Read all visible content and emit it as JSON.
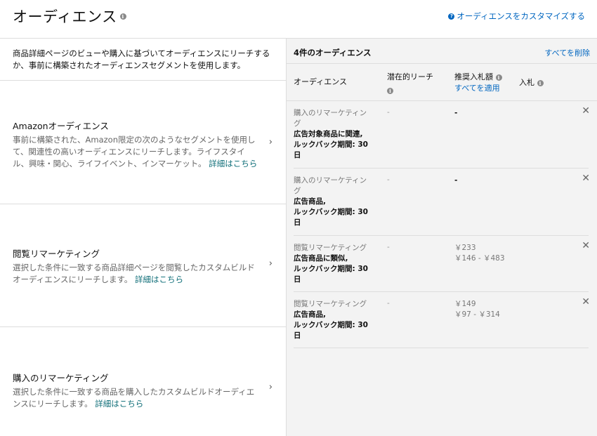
{
  "header": {
    "title": "オーディエンス",
    "info_icon": "info-icon",
    "customize_label": "オーディエンスをカスタマイズする",
    "customize_icon": "help-icon"
  },
  "intro": "商品詳細ページのビューや購入に基づいてオーディエンスにリーチするか、事前に構築されたオーディエンスセグメントを使用します。",
  "panels": [
    {
      "title": "Amazonオーディエンス",
      "description": "事前に構築された、Amazon限定の次のようなセグメントを使用して、関連性の高いオーディエンスにリーチします。ライフスタイル、興味・関心、ライフイベント、インマーケット。",
      "more": "詳細はこちら"
    },
    {
      "title": "閲覧リマーケティング",
      "description": "選択した条件に一致する商品詳細ページを閲覧したカスタムビルドオーディエンスにリーチします。",
      "more": "詳細はこちら"
    },
    {
      "title": "購入のリマーケティング",
      "description": "選択した条件に一致する商品を購入したカスタムビルドオーディエンスにリーチします。",
      "more": "詳細はこちら"
    }
  ],
  "audiences": {
    "count_label": "4件のオーディエンス",
    "clear_all": "すべてを削除",
    "columns": {
      "audience": "オーディエンス",
      "reach": "潜在的リーチ",
      "suggested_bid": "推奨入札額",
      "apply_all": "すべてを適用",
      "bid": "入札"
    },
    "rows": [
      {
        "type": "購入のリマーケティング",
        "product": "広告対象商品に関連,",
        "lookback": "ルックバック期間: 30日",
        "reach": "-",
        "bid": "-",
        "range": ""
      },
      {
        "type": "購入のリマーケティング",
        "product": "広告商品,",
        "lookback": "ルックバック期間: 30日",
        "reach": "-",
        "bid": "-",
        "range": ""
      },
      {
        "type": "閲覧リマーケティング",
        "product": "広告商品に類似,",
        "lookback": "ルックバック期間: 30日",
        "reach": "-",
        "bid": "￥233",
        "range": "￥146 - ￥483"
      },
      {
        "type": "閲覧リマーケティング",
        "product": "広告商品,",
        "lookback": "ルックバック期間: 30日",
        "reach": "-",
        "bid": "￥149",
        "range": "￥97 - ￥314"
      }
    ],
    "remove_icon": "close-icon"
  },
  "chevron_icon": "chevron-right-icon"
}
